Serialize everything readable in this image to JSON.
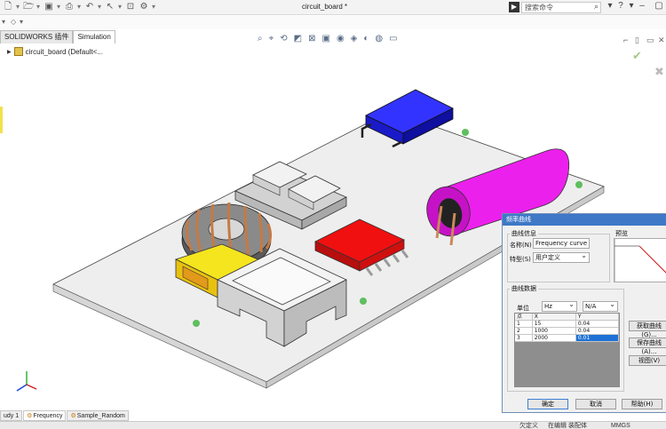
{
  "window": {
    "title": "circuit_board *",
    "search_placeholder": "搜索命令"
  },
  "tabs": [
    {
      "label": "SOLIDWORKS 插件"
    },
    {
      "label": "Simulation"
    }
  ],
  "tree": {
    "root_label": "circuit_board  (Default<..."
  },
  "bottom_tabs": [
    {
      "label": "udy 1"
    },
    {
      "label": "Frequency"
    },
    {
      "label": "Sample_Random"
    }
  ],
  "status": {
    "left": "欠定义",
    "middle": "在编辑 装配体",
    "right": "MMGS"
  },
  "dialog": {
    "title": "频率曲线",
    "info_group": "曲线信息",
    "name_label": "名称(N)",
    "name_value": "Frequency curve",
    "type_label": "特型(S)",
    "type_value": "用户定义",
    "preview_label": "预览",
    "data_group": "曲线数据",
    "unit_label": "单位",
    "unit_x": "Hz",
    "unit_y": "N/A",
    "table": {
      "headers": [
        "点",
        "X",
        "Y"
      ],
      "rows": [
        [
          "1",
          "15",
          "0.04"
        ],
        [
          "2",
          "1000",
          "0.04"
        ],
        [
          "3",
          "2000",
          "0.01"
        ]
      ]
    },
    "get_curve_button": "获取曲线(G)...",
    "save_curve_button": "保存曲线(A)...",
    "view_button": "视图(V)",
    "ok_button": "确定",
    "cancel_button": "取消",
    "help_button": "帮助(H)"
  },
  "colors": {
    "dialog_title_bar": "#3e78c6",
    "selection": "#1e72d6",
    "capacitor": "#e11de6",
    "ic_chip": "#e80e0e",
    "blue_component": "#1a1ae0",
    "yellow_component": "#f4e21a",
    "board": "#ededed"
  }
}
